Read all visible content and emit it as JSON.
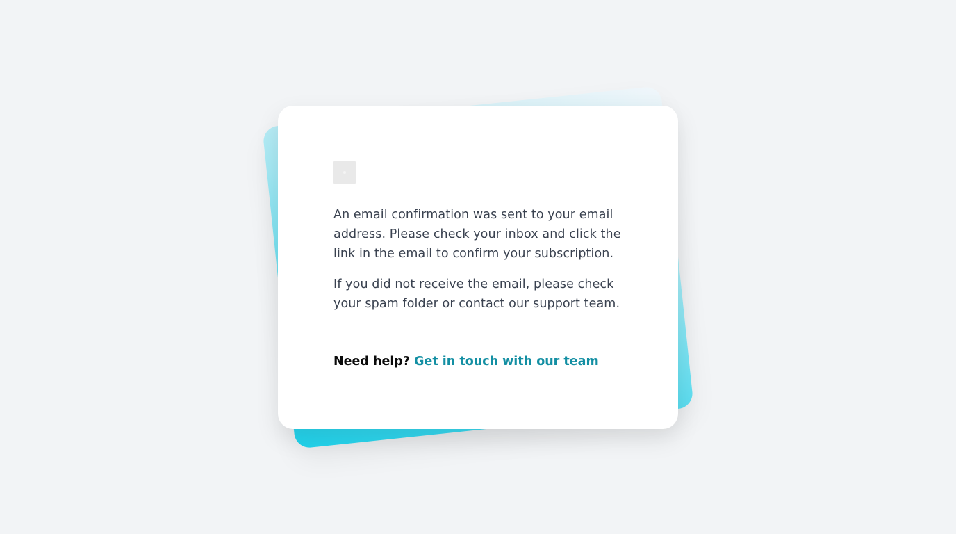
{
  "card": {
    "logo_icon": "placeholder-image-icon",
    "paragraphs": [
      "An email confirmation was sent to your email address. Please check your inbox and click the link in the email to confirm your subscription.",
      "If you did not receive the email, please check your spam folder or contact our support team."
    ],
    "help_label": "Need help?",
    "help_link": "Get in touch with our team"
  },
  "colors": {
    "background": "#f2f4f6",
    "accent_cyan": "#1fd3ec",
    "link": "#138fa3",
    "text": "#3a4250"
  }
}
